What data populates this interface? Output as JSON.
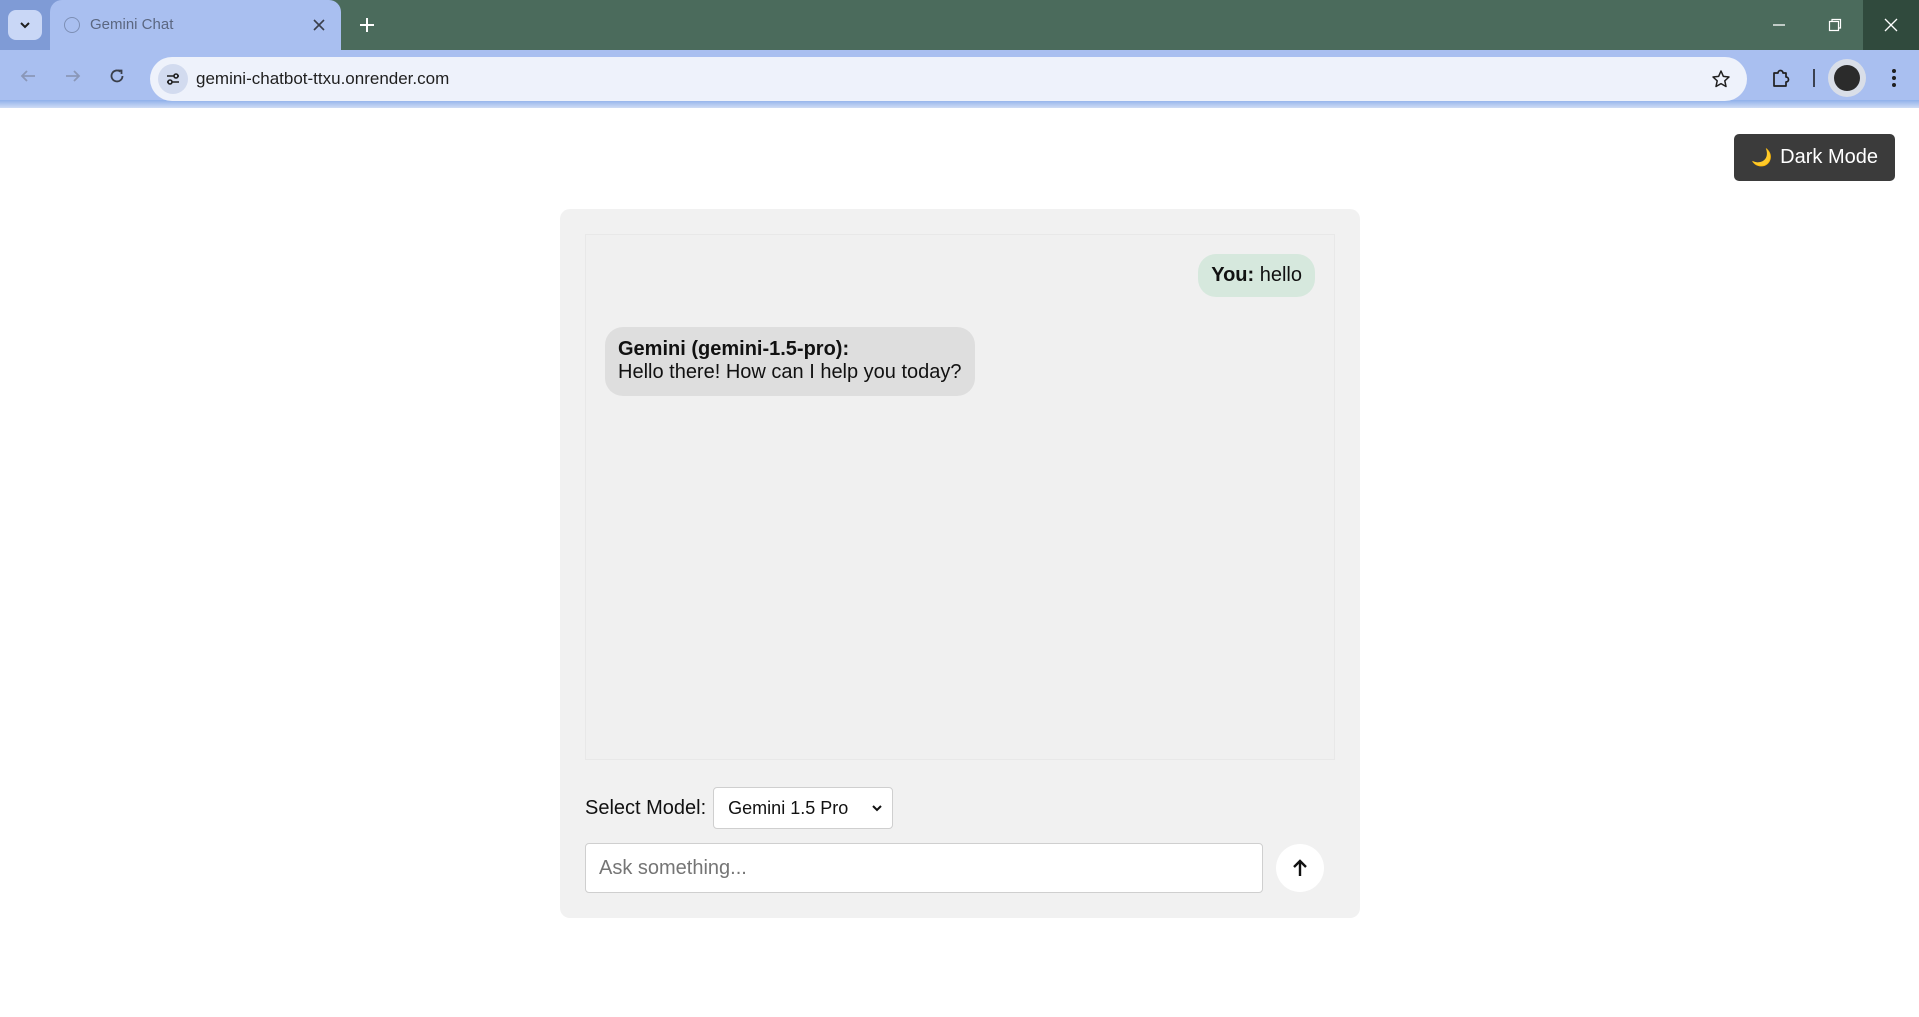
{
  "browser": {
    "tab_title": "Gemini Chat",
    "url": "gemini-chatbot-ttxu.onrender.com",
    "icons": {
      "tab_search": "chevron-down-icon",
      "favicon": "globe-icon",
      "tab_close": "close-icon",
      "new_tab": "plus-icon",
      "back": "arrow-left-icon",
      "forward": "arrow-right-icon",
      "reload": "reload-icon",
      "site_info": "tune-icon",
      "bookmark": "star-icon",
      "extensions": "puzzle-icon",
      "profile": "avatar",
      "menu": "kebab-menu-icon",
      "minimize": "minimize-icon",
      "restore": "restore-icon",
      "close": "close-icon"
    }
  },
  "page": {
    "dark_mode_icon": "🌙",
    "dark_mode_label": "Dark Mode",
    "messages": {
      "user": {
        "speaker": "You:",
        "text": "hello"
      },
      "bot": {
        "speaker": "Gemini (gemini-1.5-pro):",
        "text": "Hello there! How can I help you today?"
      }
    },
    "model_label": "Select Model:",
    "model_selected": "Gemini 1.5 Pro",
    "input_placeholder": "Ask something...",
    "input_value": ""
  },
  "colors": {
    "tabstrip": "#4b6b5c",
    "toolbar": "#a9bff0",
    "dark_button": "#3b3b3b",
    "panel": "#f1f1f1",
    "user_bubble": "#d6e8dd",
    "bot_bubble": "#dedede"
  }
}
